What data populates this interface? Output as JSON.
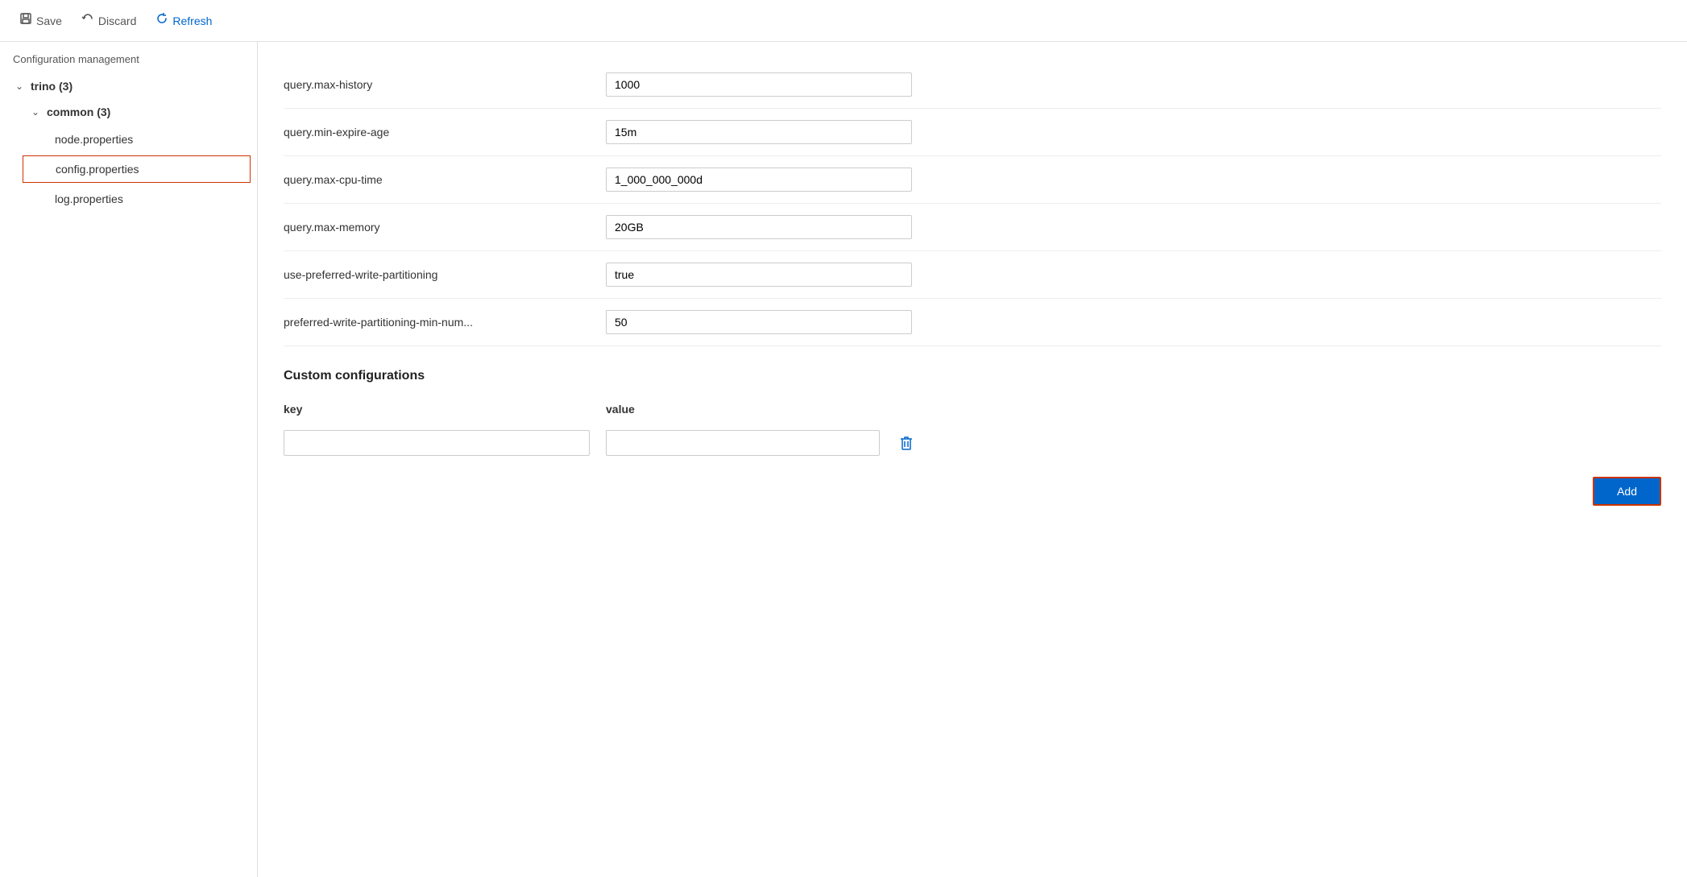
{
  "toolbar": {
    "save_label": "Save",
    "discard_label": "Discard",
    "refresh_label": "Refresh"
  },
  "sidebar": {
    "section_title": "Configuration management",
    "tree": {
      "root_label": "trino (3)",
      "root_expanded": true,
      "child_label": "common (3)",
      "child_expanded": true,
      "leaves": [
        {
          "label": "node.properties",
          "selected": false
        },
        {
          "label": "config.properties",
          "selected": true
        },
        {
          "label": "log.properties",
          "selected": false
        }
      ]
    }
  },
  "right_panel": {
    "configs": [
      {
        "key": "query.max-history",
        "value": "1000"
      },
      {
        "key": "query.min-expire-age",
        "value": "15m"
      },
      {
        "key": "query.max-cpu-time",
        "value": "1_000_000_000d"
      },
      {
        "key": "query.max-memory",
        "value": "20GB"
      },
      {
        "key": "use-preferred-write-partitioning",
        "value": "true"
      },
      {
        "key": "preferred-write-partitioning-min-num...",
        "value": "50"
      }
    ],
    "custom_section_title": "Custom configurations",
    "custom_key_label": "key",
    "custom_value_label": "value",
    "custom_rows": [
      {
        "key": "",
        "value": ""
      }
    ],
    "add_button_label": "Add"
  }
}
